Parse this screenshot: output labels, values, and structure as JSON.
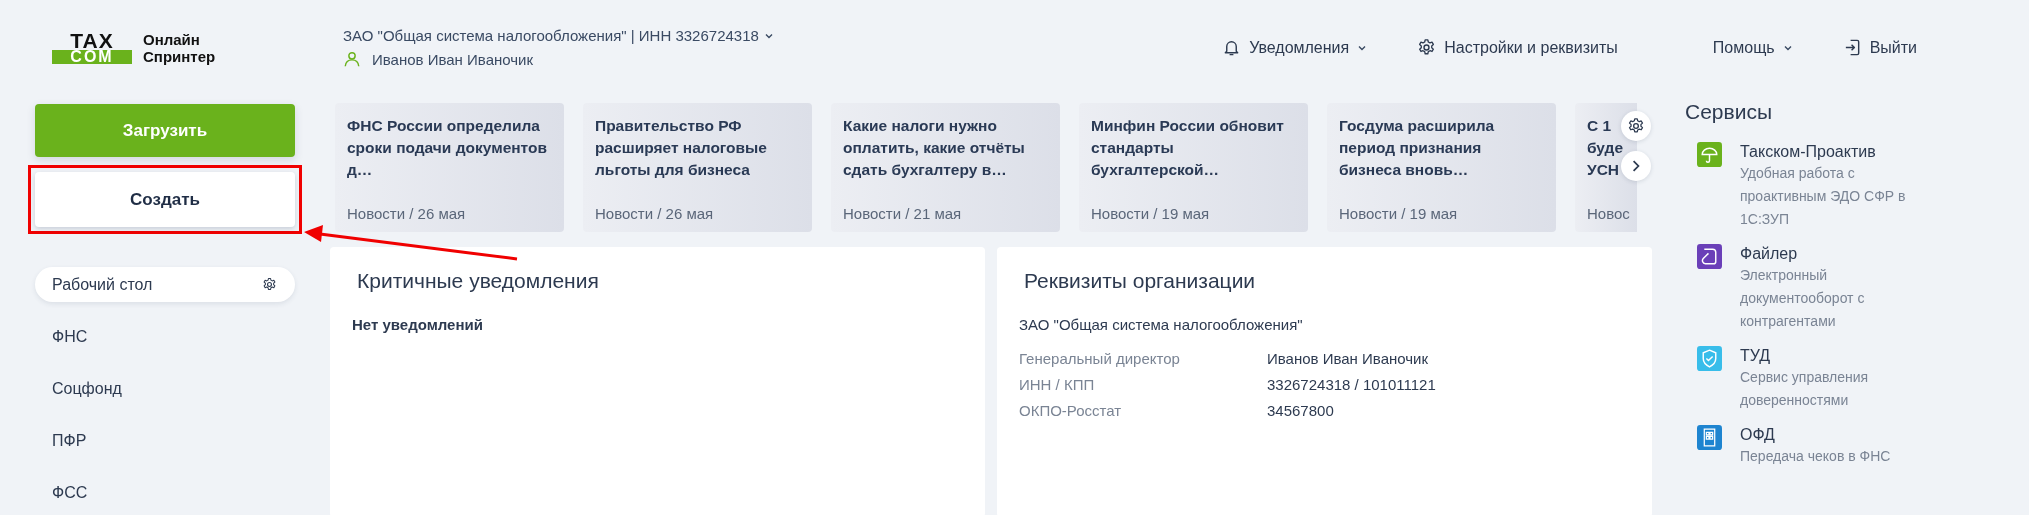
{
  "logo": {
    "mark_top": "TAX",
    "mark_bottom": "COM",
    "product_line_1": "Онлайн",
    "product_line_2": "Спринтер"
  },
  "header": {
    "organization": "ЗАО \"Общая система налогообложения\" | ИНН 3326724318",
    "user": "Иванов Иван Иваночик",
    "nav": [
      {
        "kind": "notifications",
        "label": "Уведомления",
        "dropdown": true
      },
      {
        "kind": "settings",
        "label": "Настройки и реквизиты",
        "dropdown": false
      },
      {
        "kind": "help",
        "label": "Помощь",
        "dropdown": true
      },
      {
        "kind": "logout",
        "label": "Выйти",
        "dropdown": false
      }
    ]
  },
  "actions": {
    "upload": "Загрузить",
    "create": "Создать",
    "create_highlighted": true
  },
  "sidebar": {
    "items": [
      {
        "label": "Рабочий стол",
        "selected": true
      },
      {
        "label": "ФНС",
        "selected": false
      },
      {
        "label": "Соцфонд",
        "selected": false
      },
      {
        "label": "ПФР",
        "selected": false
      },
      {
        "label": "ФСС",
        "selected": false
      }
    ]
  },
  "news": [
    {
      "title": "ФНС России определила сроки подачи документов д…",
      "meta": "Новости / 26 мая"
    },
    {
      "title": "Правительство РФ расширяет налоговые льготы для бизнеса",
      "meta": "Новости / 26 мая"
    },
    {
      "title": "Какие налоги нужно оплатить, какие отчёты сдать бухгалтеру в…",
      "meta": "Новости / 21 мая"
    },
    {
      "title": "Минфин России обновит стандарты бухгалтерской…",
      "meta": "Новости / 19 мая"
    },
    {
      "title": "Госдума расширила период признания бизнеса вновь…",
      "meta": "Новости / 19 мая"
    },
    {
      "title": "С 1 буде УСН",
      "meta": "Новос"
    }
  ],
  "critical": {
    "title": "Критичные уведомления",
    "empty_text": "Нет уведомлений"
  },
  "requisites": {
    "title": "Реквизиты организации",
    "organization": "ЗАО \"Общая система налогообложения\"",
    "rows": [
      {
        "label": "Генеральный директор",
        "value": "Иванов Иван Иваночик"
      },
      {
        "label": "ИНН / КПП",
        "value": "3326724318 / 101011121"
      },
      {
        "label": "ОКПО-Росстат",
        "value": "34567800"
      }
    ]
  },
  "services": {
    "title": "Сервисы",
    "items": [
      {
        "name": "Такском-Проактив",
        "description": "Удобная работа с проактивным ЭДО СФР в 1С:ЗУП",
        "color": "#6ab21c"
      },
      {
        "name": "Файлер",
        "description": "Электронный документооборот с контрагентами",
        "color": "#6a3fb8"
      },
      {
        "name": "ТУД",
        "description": "Сервис управления доверенностями",
        "color": "#38bdea"
      },
      {
        "name": "ОФД",
        "description": "Передача чеков в ФНС",
        "color": "#1e84d0"
      }
    ]
  }
}
